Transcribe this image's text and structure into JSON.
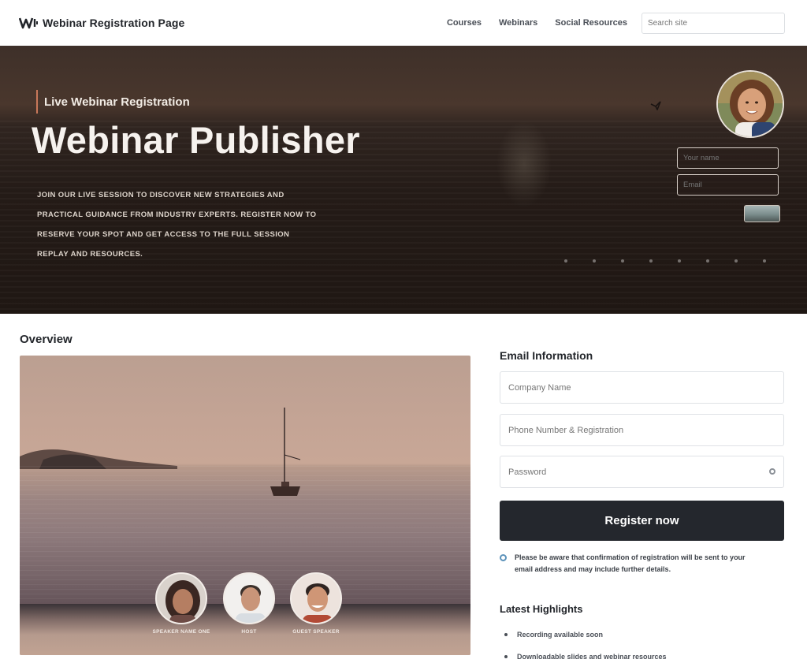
{
  "header": {
    "logo_text": "Webinar Registration Page",
    "nav": [
      "Courses",
      "Webinars",
      "Social Resources"
    ],
    "search_placeholder": "Search site"
  },
  "hero": {
    "eyebrow": "Live Webinar Registration",
    "title": "Webinar Publisher",
    "description": "Join our live session to discover new strategies and practical guidance from industry experts. Register now to reserve your spot and get access to the full session replay and resources.",
    "field_name": "Your name",
    "field_email": "Email",
    "slide_dots": 8
  },
  "left": {
    "section_title": "Overview",
    "speakers": [
      {
        "name": "Speaker Name One"
      },
      {
        "name": "Host"
      },
      {
        "name": "Guest Speaker"
      }
    ]
  },
  "form": {
    "title": "Email Information",
    "fields": {
      "company": "Company Name",
      "phone": "Phone Number & Registration",
      "password": "Password"
    },
    "submit_label": "Register now",
    "info_text": "Please be aware that confirmation of registration will be sent to your email address and may include further details."
  },
  "sidebar": {
    "title": "Latest Highlights",
    "items": [
      "Recording available soon",
      "Downloadable slides and webinar resources"
    ]
  },
  "colors": {
    "primary_button": "#24272d",
    "accent": "#c9785a",
    "info_icon": "#5c92ba"
  }
}
